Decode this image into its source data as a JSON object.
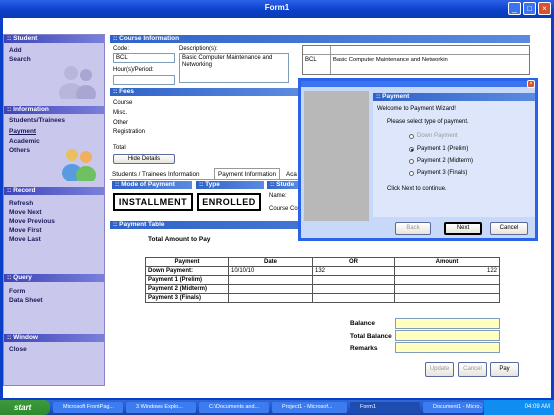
{
  "window": {
    "title": "Form1",
    "min": "_",
    "max": "□",
    "close": "×"
  },
  "sidebar": {
    "student": {
      "header": ":: Student",
      "items": [
        "Add",
        "Search"
      ]
    },
    "information": {
      "header": ":: Information",
      "items": [
        "Students/Trainees",
        "Payment",
        "Academic",
        "Others"
      ]
    },
    "record": {
      "header": ":: Record",
      "items": [
        "Refresh",
        "Move Next",
        "Move Previous",
        "Move First",
        "Move Last"
      ]
    },
    "query": {
      "header": ":: Query",
      "items": [
        "Form",
        "Data Sheet"
      ]
    },
    "window": {
      "header": ":: Window",
      "items": [
        "Close"
      ]
    }
  },
  "course": {
    "header": ":: Course Information",
    "code_label": "Code:",
    "code_value": "BCL",
    "description_label": "Description(s):",
    "description_value": "Basic Computer Maintenance and Networking",
    "hours_label": "Hour(s)/Period:",
    "grid_code": "BCL",
    "grid_desc": "Basic Computer Maintenance and Networkin"
  },
  "fees": {
    "header": ":: Fees",
    "rows": [
      "Course",
      "Misc.",
      "Other",
      "Registration"
    ],
    "total_label": "Total",
    "hide_details": "Hide Details"
  },
  "tabs": [
    "Students / Trainees Information",
    "Payment Information",
    "Aca"
  ],
  "mode": {
    "header": ":: Mode of Payment",
    "value": "INSTALLMENT"
  },
  "type": {
    "header": ":: Type",
    "value": "ENROLLED"
  },
  "student_panel": {
    "header": ":: Stude",
    "name_label": "Name:",
    "course_label": "Course Co"
  },
  "payment_table": {
    "header": ":: Payment Table",
    "total_amount_label": "Total Amount to Pay",
    "columns": [
      "Payment",
      "Date",
      "OR",
      "Amount"
    ],
    "rows": [
      {
        "payment": "Down Payment:",
        "date": "10/10/10",
        "or": "132",
        "amount": "122"
      },
      {
        "payment": "Payment 1 (Prelim)",
        "date": "",
        "or": "",
        "amount": ""
      },
      {
        "payment": "Payment 2 (Midterm)",
        "date": "",
        "or": "",
        "amount": ""
      },
      {
        "payment": "Payment 3 (Finals)",
        "date": "",
        "or": "",
        "amount": ""
      }
    ],
    "balance_label": "Balance",
    "total_balance_label": "Total Balance",
    "remarks_label": "Remarks",
    "update": "Update",
    "cancel": "Cancel",
    "pay": "Pay"
  },
  "wizard": {
    "header": ":: Payment",
    "welcome": "Welcome to Payment Wizard!",
    "instruction": "Please select type of payment.",
    "options": [
      "Down Payment",
      "Payment 1 (Prelim)",
      "Payment 2 (Midterm)",
      "Payment 3 (Finals)"
    ],
    "selected_index": 1,
    "footer": "Click Next to continue.",
    "back": "Back",
    "next": "Next",
    "cancel": "Cancel"
  },
  "taskbar": {
    "start": "start",
    "tasks": [
      "Microsoft FrontPag...",
      "3 Windows Explo...",
      "C:\\Documents and...",
      "Project1 - Microsof...",
      "Form1",
      "Document1 - Micro..."
    ],
    "time": "04:09 AM"
  },
  "colors": {
    "accent": "#2f63c8",
    "sidebar": "#c9c8ec",
    "dialog": "#c8d8f8",
    "highlight": "#ffffc0"
  }
}
